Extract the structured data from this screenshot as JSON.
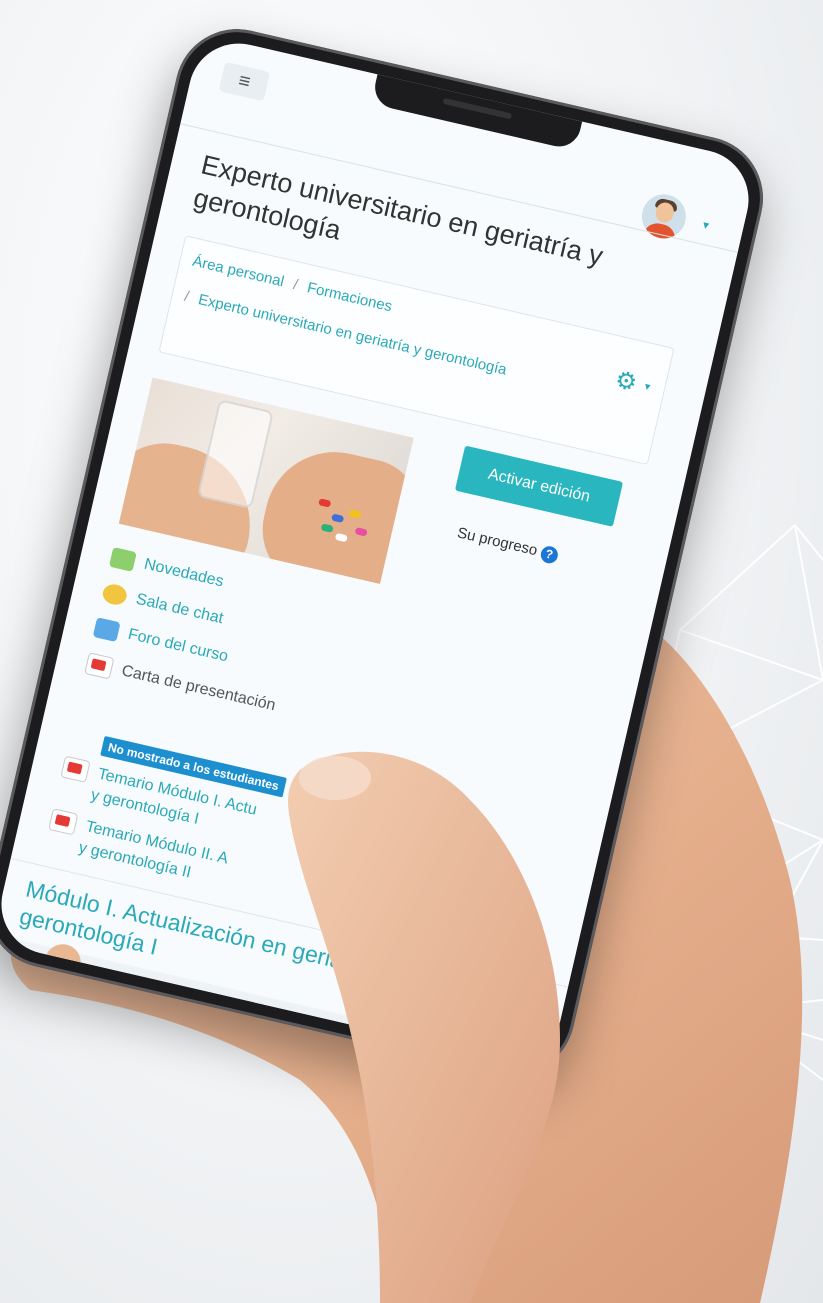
{
  "header": {
    "menu_icon": "hamburger-icon",
    "user_avatar": "user-avatar-icon",
    "avatar_menu_caret": "caret-down-icon"
  },
  "course": {
    "title": "Experto universitario en geriatría y gerontología"
  },
  "breadcrumb": {
    "items": [
      "Área personal",
      "Formaciones",
      "Experto universitario en geriatría y gerontología"
    ],
    "separator": "/"
  },
  "actions": {
    "settings_icon": "gear-icon",
    "edit_button": "Activar edición",
    "progress_label": "Su progreso",
    "help_icon_text": "?"
  },
  "activities": [
    {
      "label": "Novedades",
      "icon": "forum-icon"
    },
    {
      "label": "Sala de chat",
      "icon": "chat-icon"
    },
    {
      "label": "Foro del curso",
      "icon": "forum-icon"
    },
    {
      "label": "Carta de presentación",
      "icon": "pdf-icon"
    },
    {
      "label": "Temario Módulo I. Actu",
      "label2": "y gerontología I",
      "icon": "pdf-icon"
    },
    {
      "label": "Temario Módulo II. A",
      "label2": "y gerontología II",
      "icon": "pdf-icon"
    }
  ],
  "hidden_badge": "No mostrado a los estudiantes",
  "module": {
    "title_line1": "Módulo I. Actualización en geriatr",
    "title_line2": "gerontología I"
  },
  "colors": {
    "accent": "#2aa9b8",
    "button": "#2ab6bf",
    "badge": "#1d8fcf",
    "help": "#1c76d6"
  }
}
